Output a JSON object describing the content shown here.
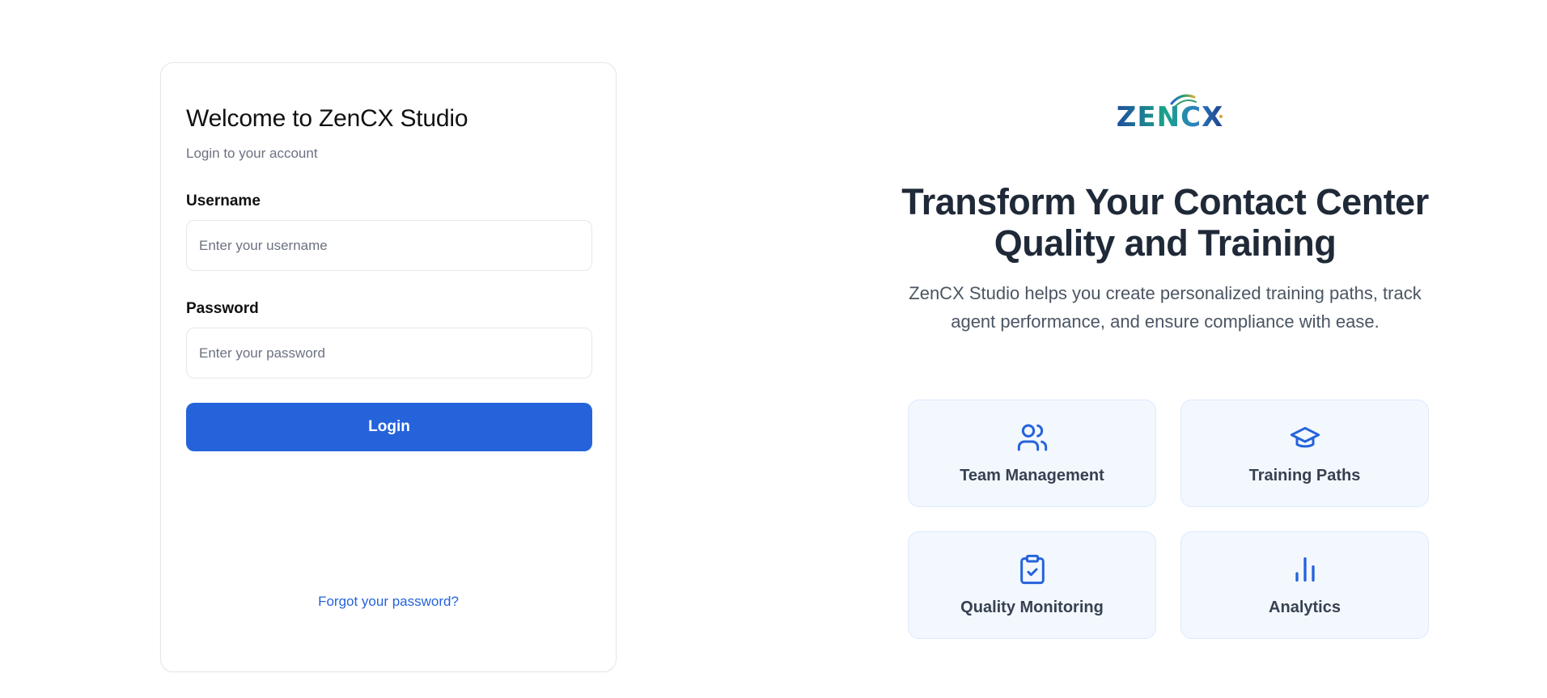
{
  "login": {
    "title": "Welcome to ZenCX Studio",
    "subtitle": "Login to your account",
    "username_label": "Username",
    "username_placeholder": "Enter your username",
    "username_value": "",
    "password_label": "Password",
    "password_placeholder": "Enter your password",
    "password_value": "",
    "login_button": "Login",
    "forgot_link": "Forgot your password?"
  },
  "brand": {
    "logo_text": "ZENCX"
  },
  "hero": {
    "title": "Transform Your Contact Center Quality and Training",
    "description": "ZenCX Studio helps you create personalized training paths, track agent performance, and ensure compliance with ease."
  },
  "features": [
    {
      "label": "Team Management",
      "icon": "users-icon"
    },
    {
      "label": "Training Paths",
      "icon": "graduation-cap-icon"
    },
    {
      "label": "Quality Monitoring",
      "icon": "clipboard-check-icon"
    },
    {
      "label": "Analytics",
      "icon": "bar-chart-icon"
    }
  ],
  "colors": {
    "primary": "#2563db",
    "feature_card_bg": "#f3f8fe",
    "heading": "#1f2937"
  }
}
